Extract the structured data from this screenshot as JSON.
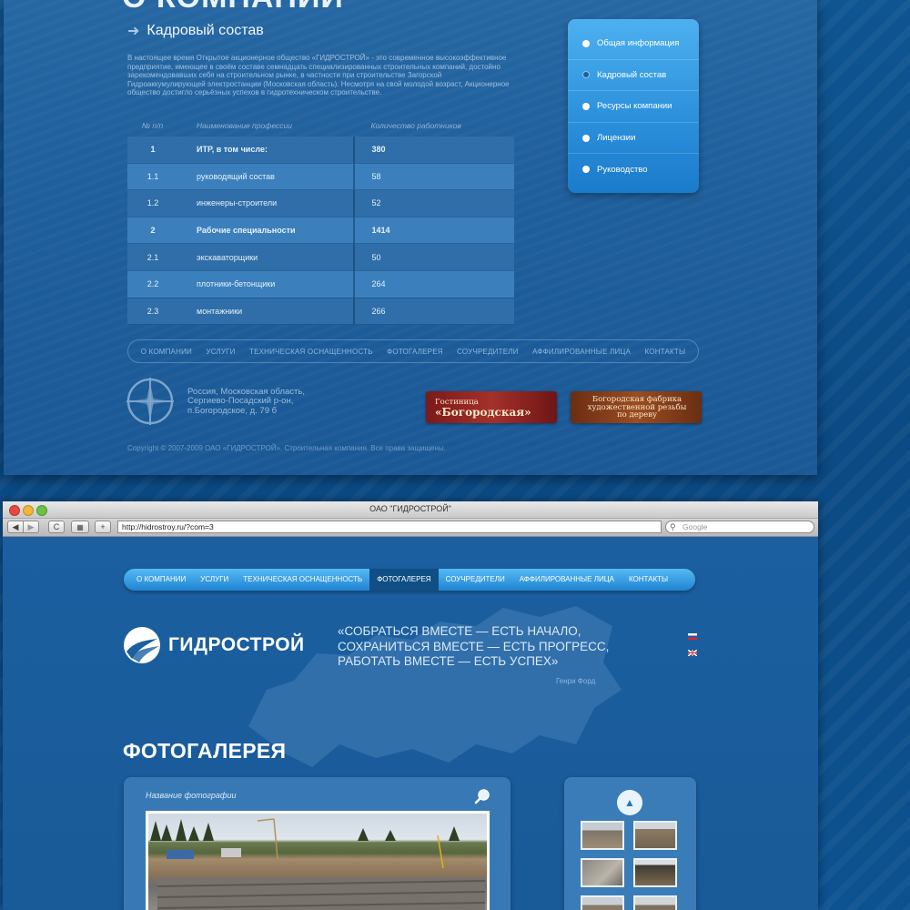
{
  "top_panel": {
    "cut_heading": "О КОМПАНИИ",
    "section_title": "Кадровый состав",
    "intro": "В настоящее время Открытое акционерное общество «ГИДРОСТРОЙ» - это современное высокоэффективное предприятие, имеющее в своём составе семнадцать специализированных строительных компаний, достойно зарекомендовавших себя на строительном рынке, в частности при строительстве Загорской Гидроаккумулирующей электростанции (Московская область). Несмотря на свой молодой возраст, Акционерное общество достигло серьёзных успехов в гидротехническом строительстве.",
    "table": {
      "headers": [
        "№ п/п",
        "Наименование профессии",
        "Количество работников"
      ],
      "rows": [
        {
          "num": "1",
          "name": "ИТР, в том числе:",
          "count": "380",
          "bold": true
        },
        {
          "num": "1.1",
          "name": "руководящий состав",
          "count": "58",
          "bold": false
        },
        {
          "num": "1.2",
          "name": "инженеры-строители",
          "count": "52",
          "bold": false
        },
        {
          "num": "2",
          "name": "Рабочие специальности",
          "count": "1414",
          "bold": true
        },
        {
          "num": "2.1",
          "name": "экскаваторщики",
          "count": "50",
          "bold": false
        },
        {
          "num": "2.2",
          "name": "плотники-бетонщики",
          "count": "264",
          "bold": false
        },
        {
          "num": "2.3",
          "name": "монтажники",
          "count": "266",
          "bold": false
        }
      ]
    },
    "side_menu": [
      {
        "label": "Общая информация",
        "active": false
      },
      {
        "label": "Кадровый состав",
        "active": true
      },
      {
        "label": "Ресурсы компании",
        "active": false
      },
      {
        "label": "Лицензии",
        "active": false
      },
      {
        "label": "Руководство",
        "active": false
      }
    ],
    "footer_nav": [
      "О КОМПАНИИ",
      "УСЛУГИ",
      "ТЕХНИЧЕСКАЯ ОСНАЩЕННОСТЬ",
      "ФОТОГАЛЕРЕЯ",
      "СОУЧРЕДИТЕЛИ",
      "АФФИЛИРОВАННЫЕ ЛИЦА",
      "КОНТАКТЫ"
    ],
    "address": [
      "Россия, Московская область,",
      "Сергиево-Посадский р-он,",
      "п.Богородское, д. 79 б"
    ],
    "banner1": {
      "line1": "Гостиница",
      "line2": "«Богородская»"
    },
    "banner2": {
      "line1": "Богородская фабрика",
      "line2": "художественной резьбы",
      "line3": "по дереву"
    },
    "copyright": "Copyright © 2007-2009 ОАО «ГИДРОСТРОЙ». Строительная компания. Все права защищены."
  },
  "browser": {
    "window_title": "ОАО \"ГИДРОСТРОЙ\"",
    "url": "http://hidrostroy.ru/?com=3",
    "search_placeholder": "Google",
    "buttons": {
      "back": "◀",
      "forward": "▶",
      "reload": "C",
      "bookmark": "+"
    }
  },
  "site": {
    "nav": [
      {
        "label": "О КОМПАНИИ",
        "active": false
      },
      {
        "label": "УСЛУГИ",
        "active": false
      },
      {
        "label": "ТЕХНИЧЕСКАЯ ОСНАЩЕННОСТЬ",
        "active": false
      },
      {
        "label": "ФОТОГАЛЕРЕЯ",
        "active": true
      },
      {
        "label": "СОУЧРЕДИТЕЛИ",
        "active": false
      },
      {
        "label": "АФФИЛИРОВАННЫЕ ЛИЦА",
        "active": false
      },
      {
        "label": "КОНТАКТЫ",
        "active": false
      }
    ],
    "logo_text": "ГИДРОСТРОЙ",
    "quote_lines": [
      "«СОБРАТЬСЯ ВМЕСТЕ — ЕСТЬ НАЧАЛО,",
      "СОХРАНИТЬСЯ ВМЕСТЕ — ЕСТЬ ПРОГРЕСС,",
      "РАБОТАТЬ ВМЕСТЕ — ЕСТЬ УСПЕХ»"
    ],
    "quote_author": "Генри Форд",
    "gallery_title": "ФОТОГАЛЕРЕЯ",
    "photo_caption": "Название фотографии"
  },
  "colors": {
    "accent": "#2a8fdb",
    "page_bg": "#0d4a82",
    "active_tab": "#0f4f86"
  }
}
